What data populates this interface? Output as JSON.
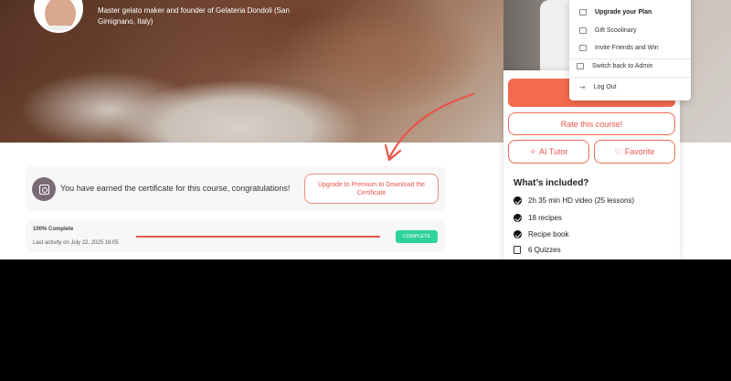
{
  "hero": {
    "instructor_description": "Master gelato maker and founder of Gelateria Dondoli (San Gimignano, Italy)"
  },
  "user_menu": {
    "items": [
      {
        "label": "Upgrade your Plan",
        "icon": "upgrade-icon",
        "bold": true
      },
      {
        "label": "Gift Scoolinary",
        "icon": "gift-icon"
      },
      {
        "label": "Invite Friends and Win",
        "icon": "invite-icon"
      },
      {
        "label": "Switch back to Admin",
        "icon": "switch-admin-icon"
      },
      {
        "label": "Log Out",
        "icon": "logout-icon"
      }
    ]
  },
  "sidebar": {
    "primary_button_label": "",
    "rate_button_label": "Rate this course!",
    "ai_tutor_label": "AI Tutor",
    "favorite_label": "Favorite",
    "included_title": "What’s included?",
    "included_items": [
      {
        "text": "2h 35 min HD video (25 lessons)",
        "icon": "check-icon"
      },
      {
        "text": "18 recipes",
        "icon": "check-icon"
      },
      {
        "text": "Recipe book",
        "icon": "check-icon"
      },
      {
        "text": "6 Quizzes",
        "icon": "quiz-icon"
      }
    ]
  },
  "certificate": {
    "message": "You have earned the certificate for this course, congratulations!",
    "upgrade_button_label": "Upgrade to Premium to Download the Certificate"
  },
  "progress": {
    "title": "100% Complete",
    "last_activity": "Last activity on July 22, 2025 16:05",
    "percent": 100,
    "status_badge": "COMPLETE"
  },
  "colors": {
    "accent": "#f56a4f",
    "success": "#2fd39a"
  }
}
